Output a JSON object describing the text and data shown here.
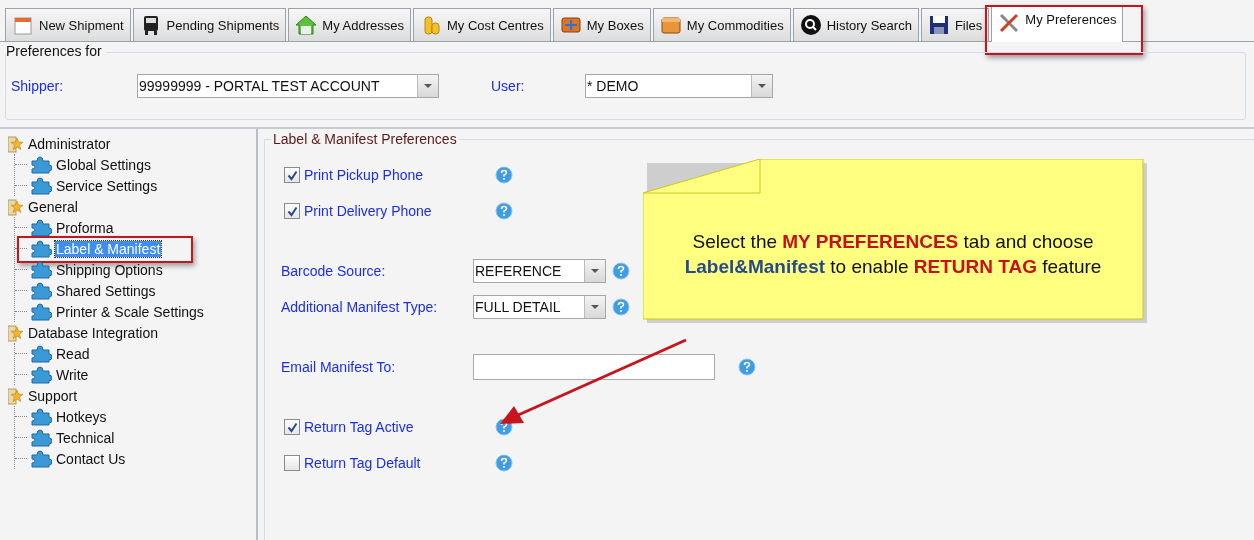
{
  "tabs": [
    {
      "label": "New Shipment",
      "kind": "calendar",
      "selected": false,
      "highlighted": false
    },
    {
      "label": "Pending Shipments",
      "kind": "truck",
      "selected": false,
      "highlighted": false
    },
    {
      "label": "My Addresses",
      "kind": "house",
      "selected": false,
      "highlighted": false
    },
    {
      "label": "My Cost Centres",
      "kind": "coins",
      "selected": false,
      "highlighted": false
    },
    {
      "label": "My Boxes",
      "kind": "crate",
      "selected": false,
      "highlighted": false
    },
    {
      "label": "My Commodities",
      "kind": "box",
      "selected": false,
      "highlighted": false
    },
    {
      "label": "History Search",
      "kind": "magnifier",
      "selected": false,
      "highlighted": false
    },
    {
      "label": "Files",
      "kind": "floppy",
      "selected": false,
      "highlighted": false
    },
    {
      "label": "My Preferences",
      "kind": "tools",
      "selected": true,
      "highlighted": true
    }
  ],
  "preferences_for": {
    "title": "Preferences for",
    "shipper": {
      "label": "Shipper:",
      "value": "99999999 - PORTAL TEST ACCOUNT"
    },
    "user": {
      "label": "User:",
      "value": "* DEMO"
    }
  },
  "tree": [
    {
      "label": "Administrator",
      "children": [
        {
          "label": "Global Settings",
          "selected": false,
          "highlighted": false
        },
        {
          "label": "Service Settings",
          "selected": false,
          "highlighted": false
        }
      ]
    },
    {
      "label": "General",
      "children": [
        {
          "label": "Proforma",
          "selected": false,
          "highlighted": false
        },
        {
          "label": "Label & Manifest",
          "selected": true,
          "highlighted": true
        },
        {
          "label": "Shipping Options",
          "selected": false,
          "highlighted": false
        },
        {
          "label": "Shared Settings",
          "selected": false,
          "highlighted": false
        },
        {
          "label": "Printer & Scale Settings",
          "selected": false,
          "highlighted": false
        }
      ]
    },
    {
      "label": "Database Integration",
      "children": [
        {
          "label": "Read",
          "selected": false,
          "highlighted": false
        },
        {
          "label": "Write",
          "selected": false,
          "highlighted": false
        }
      ]
    },
    {
      "label": "Support",
      "children": [
        {
          "label": "Hotkeys",
          "selected": false,
          "highlighted": false
        },
        {
          "label": "Technical",
          "selected": false,
          "highlighted": false
        },
        {
          "label": "Contact Us",
          "selected": false,
          "highlighted": false
        }
      ]
    }
  ],
  "panel": {
    "title": "Label & Manifest Preferences",
    "fields": [
      {
        "kind": "checkbox",
        "label": "Print Pickup Phone",
        "checked": true
      },
      {
        "kind": "checkbox",
        "label": "Print Delivery Phone",
        "checked": true
      },
      {
        "kind": "select",
        "label": "Barcode Source:",
        "value": "REFERENCE"
      },
      {
        "kind": "select",
        "label": "Additional Manifest Type:",
        "value": "FULL DETAIL"
      },
      {
        "kind": "text",
        "label": "Email Manifest To:"
      },
      {
        "kind": "checkbox",
        "label": "Return Tag Active",
        "checked": true
      },
      {
        "kind": "checkbox",
        "label": "Return Tag Default",
        "checked": false
      }
    ]
  },
  "callout": {
    "lines": [
      {
        "segments": [
          {
            "text": "Select the ",
            "kind": "plain"
          },
          {
            "text": "MY PREFERENCES",
            "kind": "alert"
          },
          {
            "text": " tab and choose",
            "kind": "plain"
          }
        ]
      },
      {
        "segments": [
          {
            "text": "Label&Manifest",
            "kind": "term"
          },
          {
            "text": " to enable ",
            "kind": "plain"
          },
          {
            "text": "RETURN TAG",
            "kind": "alert"
          },
          {
            "text": " feature",
            "kind": "plain"
          }
        ]
      }
    ]
  }
}
